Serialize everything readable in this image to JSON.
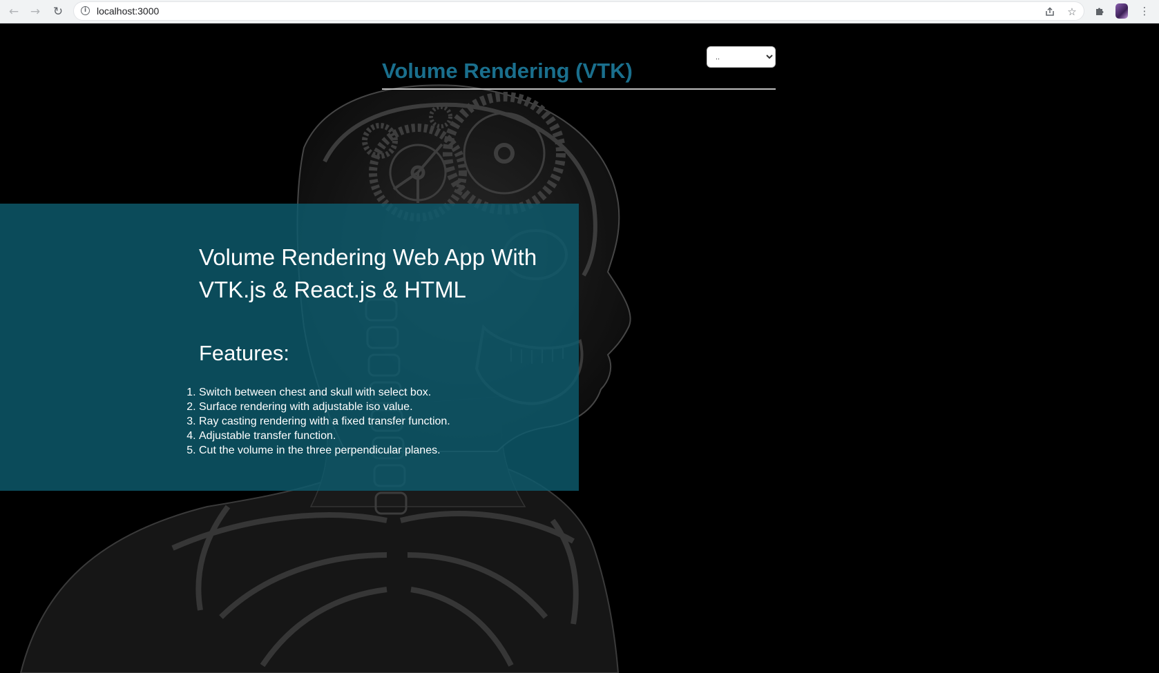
{
  "browser": {
    "url": "localhost:3000",
    "icons": [
      "back-arrow-icon",
      "forward-arrow-icon",
      "reload-icon",
      "site-info-icon",
      "share-icon",
      "bookmark-star-icon",
      "extensions-puzzle-icon",
      "profile-avatar",
      "kebab-menu-icon"
    ]
  },
  "header": {
    "title": "Volume Rendering (VTK)",
    "title_color": "#1a6f8d",
    "select_value": ".."
  },
  "intro": {
    "heading": "Volume Rendering Web App With VTK.js & React.js & HTML",
    "features_heading": "Features:",
    "features": [
      "Switch between chest and skull with select box.",
      "Surface rendering with adjustable iso value.",
      "Ray casting rendering with a fixed transfer function.",
      "Adjustable transfer function.",
      "Cut the volume in the three perpendicular planes."
    ],
    "panel_color": "#0e5c6e"
  }
}
